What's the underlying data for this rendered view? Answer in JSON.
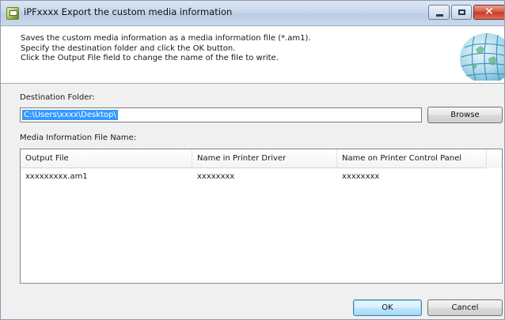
{
  "window": {
    "title": "iPFxxxx Export the custom media information"
  },
  "header": {
    "line1": "Saves the custom media information as a media information file (*.am1).",
    "line2": "Specify the destination folder and click the OK button.",
    "line3": "Click the Output File field to change the name of the file to write.",
    "icon": "globe-icon"
  },
  "destination": {
    "label": "Destination Folder:",
    "value": "C:\\Users\\xxxx\\Desktop\\",
    "browse_label": "Browse"
  },
  "media": {
    "label": "Media Information File Name:",
    "columns": [
      "Output File",
      "Name in Printer Driver",
      "Name on Printer Control Panel"
    ],
    "rows": [
      [
        "xxxxxxxxx.am1",
        "xxxxxxxx",
        "xxxxxxxx"
      ]
    ]
  },
  "footer": {
    "ok_label": "OK",
    "cancel_label": "Cancel"
  },
  "colors": {
    "selection": "#3399ff",
    "close_button": "#c43a24",
    "titlebar": "#c6d6ea"
  }
}
